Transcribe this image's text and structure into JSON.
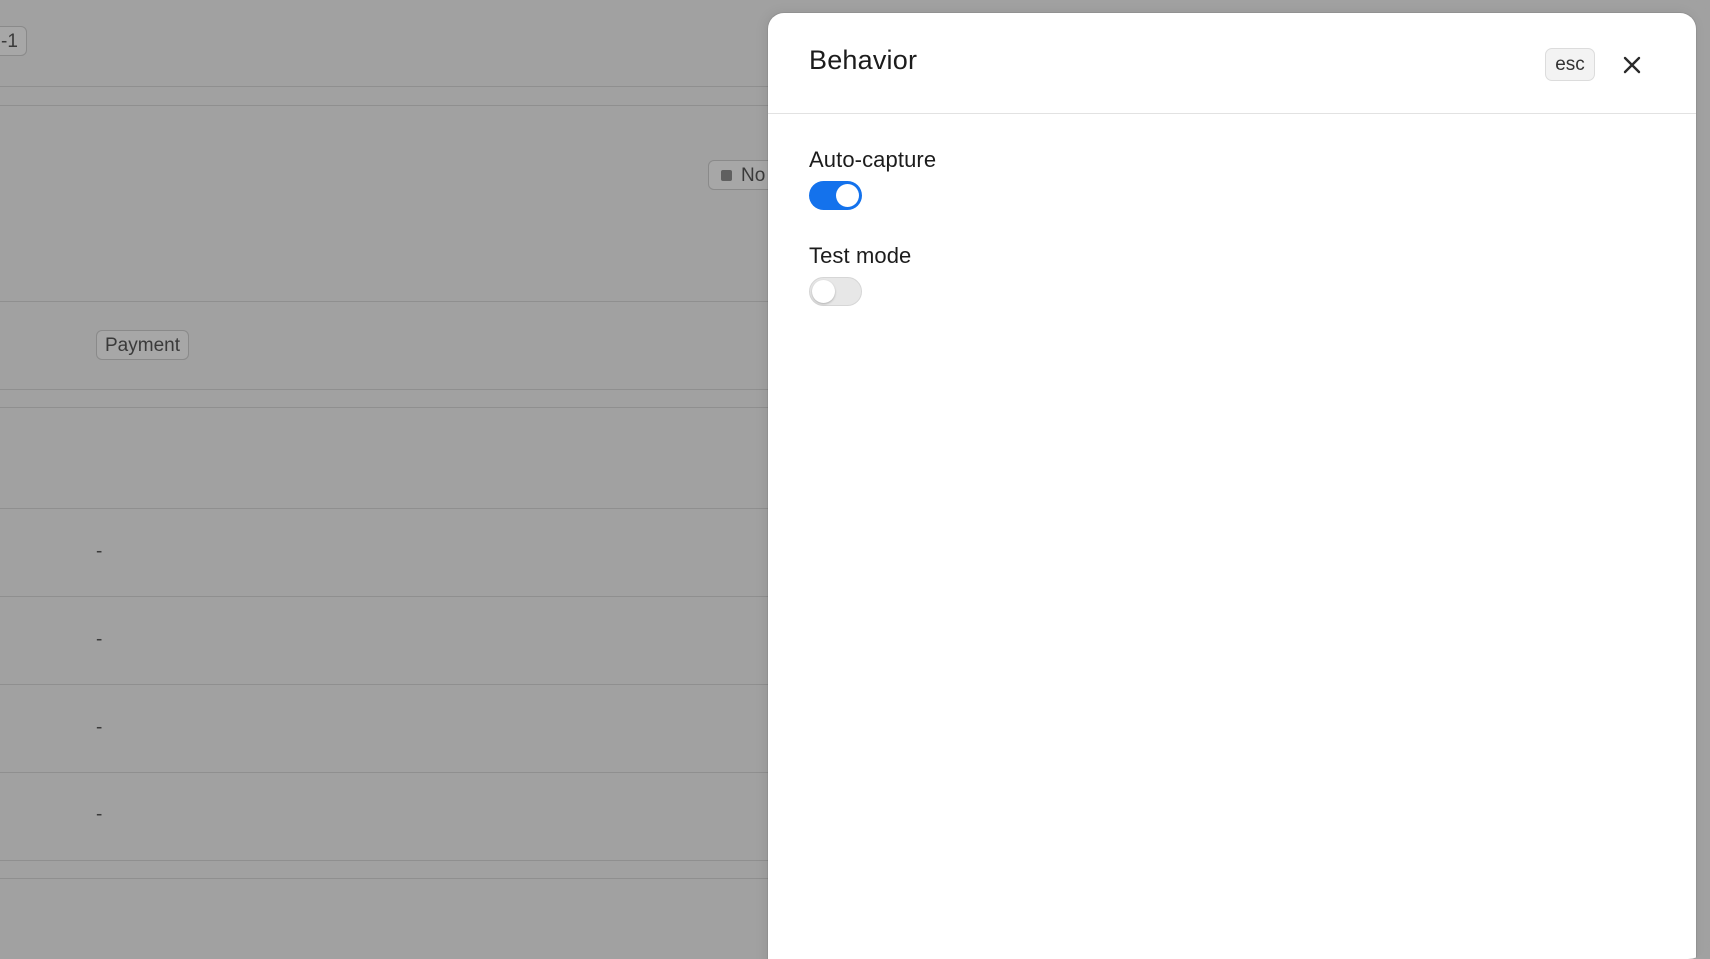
{
  "background": {
    "negative_chip": "-1",
    "status_chip": "No",
    "payment_chip": "Payment",
    "dashes": [
      "-",
      "-",
      "-",
      "-"
    ]
  },
  "panel": {
    "title": "Behavior",
    "esc_label": "esc",
    "settings": [
      {
        "label": "Auto-capture",
        "enabled": true
      },
      {
        "label": "Test mode",
        "enabled": false
      }
    ]
  },
  "colors": {
    "toggle_on": "#1472ec",
    "toggle_off": "#e7e7e7",
    "overlay": "#a1a1a1"
  },
  "icons": {
    "close": "close-icon"
  }
}
